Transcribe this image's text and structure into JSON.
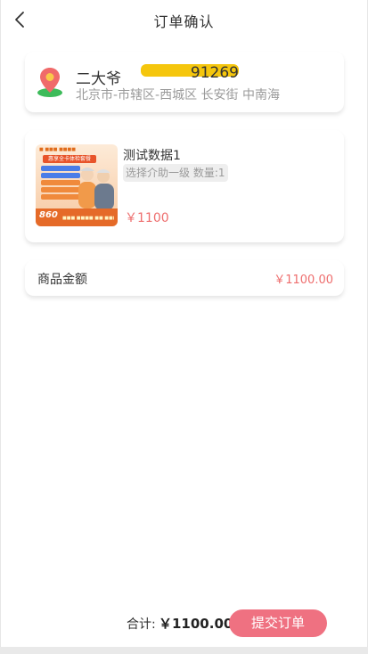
{
  "header": {
    "title": "订单确认",
    "back_icon": "chevron-left-icon"
  },
  "address": {
    "pin_icon": "location-pin-icon",
    "name": "二大爷",
    "phone_tail": "91269",
    "detail": "北京市-市辖区-西城区 长安街 中南海",
    "colors": {
      "mask": "#f5c60d",
      "pin": "#f06a6a",
      "pin_base": "#3dbb5a"
    }
  },
  "product": {
    "name": "测试数据1",
    "spec": "选择介助一级 数量:1",
    "price": "￥1100",
    "thumb": {
      "banner": "惠享全卡体检套餐",
      "price_tag": "860"
    }
  },
  "amount": {
    "label": "商品金额",
    "value": "￥1100.00"
  },
  "footer": {
    "total_label": "合计:",
    "total_value": "￥1100.00",
    "submit_label": "提交订单"
  },
  "colors": {
    "accent": "#ef7181",
    "price": "#ee6e6e",
    "muted": "#9a9a9a",
    "text": "#333333"
  }
}
